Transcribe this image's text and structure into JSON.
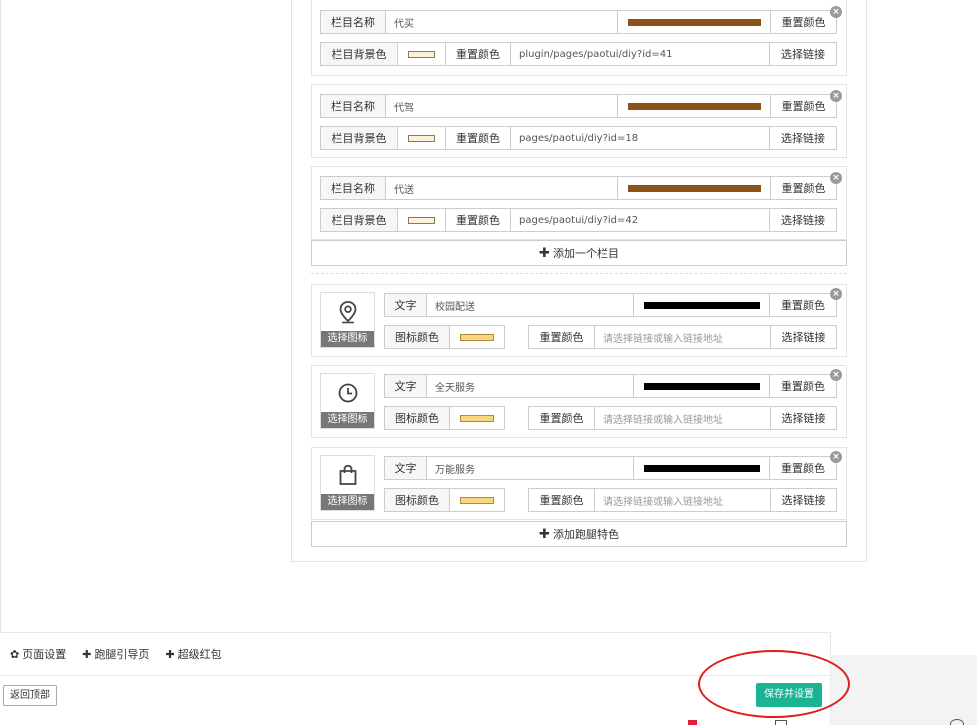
{
  "labels": {
    "column_name": "栏目名称",
    "column_bg_color": "栏目背景色",
    "reset_color": "重置颜色",
    "choose_link": "选择链接",
    "text": "文字",
    "icon_color": "图标颜色",
    "choose_icon": "选择图标",
    "close": "×"
  },
  "columns": [
    {
      "name": "代买",
      "name_color": "#8b5219",
      "bg_color": "#fdf2d9",
      "link": "plugin/pages/paotui/diy?id=41"
    },
    {
      "name": "代驾",
      "name_color": "#8b5219",
      "bg_color": "#fdf2d9",
      "link": "pages/paotui/diy?id=18"
    },
    {
      "name": "代送",
      "name_color": "#8b5219",
      "bg_color": "#fdf2d9",
      "link": "pages/paotui/diy?id=42"
    }
  ],
  "add_column_label": "添加一个栏目",
  "features": [
    {
      "icon": "location-pin-icon",
      "text": "校园配送",
      "text_color": "#000000",
      "icon_color": "#f9d57c",
      "link_placeholder": "请选择链接或输入链接地址"
    },
    {
      "icon": "clock-icon",
      "text": "全天服务",
      "text_color": "#000000",
      "icon_color": "#f9d57c",
      "link_placeholder": "请选择链接或输入链接地址"
    },
    {
      "icon": "shopping-bag-icon",
      "text": "万能服务",
      "text_color": "#000000",
      "icon_color": "#f9d57c",
      "link_placeholder": "请选择链接或输入链接地址"
    }
  ],
  "add_feature_label": "添加跑腿特色",
  "bottom": {
    "tabs": [
      {
        "icon": "gear-icon",
        "label": "页面设置"
      },
      {
        "icon": "plus-icon",
        "label": "跑腿引导页"
      },
      {
        "icon": "plus-icon",
        "label": "超级红包"
      }
    ],
    "back_to_top": "返回顶部",
    "save": "保存并设置"
  },
  "colors": {
    "accent": "#1ab394",
    "annotation": "#e01b1b"
  }
}
